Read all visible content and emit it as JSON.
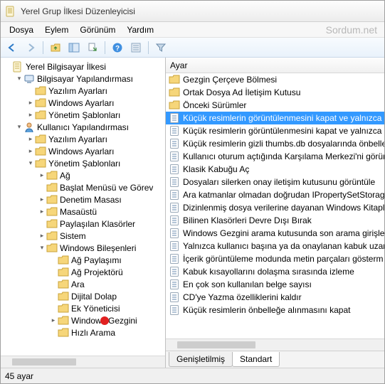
{
  "window": {
    "title": "Yerel Grup İlkesi Düzenleyicisi",
    "watermark": "Sordum.net"
  },
  "menu": {
    "file": "Dosya",
    "action": "Eylem",
    "view": "Görünüm",
    "help": "Yardım"
  },
  "tree": {
    "root": "Yerel Bilgisayar İlkesi",
    "computer_config": "Bilgisayar Yapılandırması",
    "software_settings": "Yazılım Ayarları",
    "windows_settings": "Windows Ayarları",
    "admin_templates": "Yönetim Şablonları",
    "user_config": "Kullanıcı Yapılandırması",
    "network": "Ağ",
    "start_menu": "Başlat Menüsü ve Görev",
    "control_panel": "Denetim Masası",
    "desktop": "Masaüstü",
    "shared_folders": "Paylaşılan Klasörler",
    "system": "Sistem",
    "windows_components": "Windows Bileşenleri",
    "net_sharing": "Ağ Paylaşımı",
    "net_projector": "Ağ Projektörü",
    "search": "Ara",
    "digital_locker": "Dijital Dolap",
    "attachment_mgr": "Ek Yöneticisi",
    "windows_explorer": "Windows Gezgini",
    "quick_search": "Hızlı Arama"
  },
  "list_header": "Ayar",
  "list": {
    "items": [
      {
        "type": "folder",
        "label": "Gezgin Çerçeve Bölmesi"
      },
      {
        "type": "folder",
        "label": "Ortak Dosya Ad İletişim Kutusu"
      },
      {
        "type": "folder",
        "label": "Önceki Sürümler"
      },
      {
        "type": "policy",
        "label": "Küçük resimlerin görüntülenmesini kapat ve yalnızca s",
        "selected": true
      },
      {
        "type": "policy",
        "label": "Küçük resimlerin görüntülenmesini kapat ve yalnızca a"
      },
      {
        "type": "policy",
        "label": "Küçük resimlerin gizli thumbs.db dosyalarında önbelle"
      },
      {
        "type": "policy",
        "label": "Kullanıcı oturum açtığında Karşılama Merkezi'ni görün"
      },
      {
        "type": "policy",
        "label": "Klasik Kabuğu Aç"
      },
      {
        "type": "policy",
        "label": "Dosyaları silerken onay iletişim kutusunu görüntüle"
      },
      {
        "type": "policy",
        "label": "Ara katmanlar olmadan doğrudan IPropertySetStorage"
      },
      {
        "type": "policy",
        "label": "Dizinlenmiş dosya verilerine dayanan Windows Kitaplı"
      },
      {
        "type": "policy",
        "label": "Bilinen Klasörleri Devre Dışı Bırak"
      },
      {
        "type": "policy",
        "label": "Windows Gezgini arama kutusunda son arama girişleri"
      },
      {
        "type": "policy",
        "label": "Yalnızca kullanıcı başına ya da onaylanan kabuk uzant"
      },
      {
        "type": "policy",
        "label": "İçerik görüntüleme modunda metin parçaları gösterm"
      },
      {
        "type": "policy",
        "label": "Kabuk kısayollarını dolaşma sırasında izleme"
      },
      {
        "type": "policy",
        "label": "En çok son kullanılan belge sayısı"
      },
      {
        "type": "policy",
        "label": "CD'ye Yazma özelliklerini kaldır"
      },
      {
        "type": "policy",
        "label": "Küçük resimlerin önbelleğe alınmasını kapat"
      }
    ]
  },
  "tabs": {
    "extended": "Genişletilmiş",
    "standard": "Standart"
  },
  "status": "45 ayar"
}
